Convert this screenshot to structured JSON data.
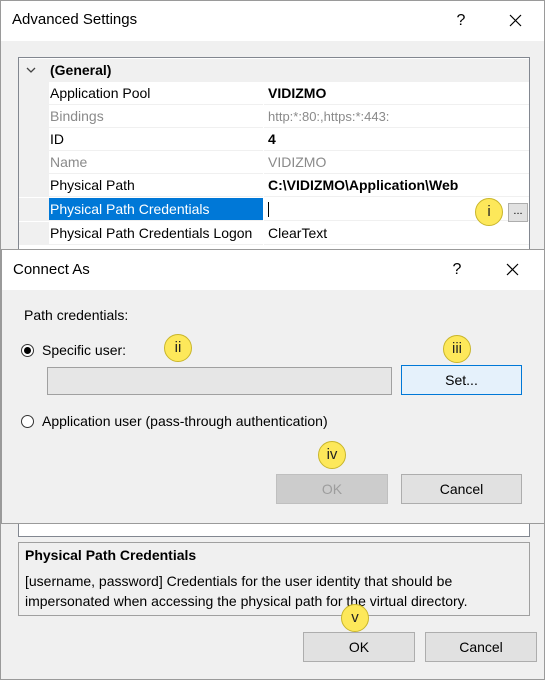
{
  "advanced": {
    "title": "Advanced Settings",
    "help": "?",
    "category": "(General)",
    "rows": [
      {
        "label": "Application Pool",
        "value": "VIDIZMO",
        "dim": false,
        "bold": true
      },
      {
        "label": "Bindings",
        "value": "http:*:80:,https:*:443:",
        "dim": true,
        "bold": false
      },
      {
        "label": "ID",
        "value": "4",
        "dim": false,
        "bold": true
      },
      {
        "label": "Name",
        "value": "VIDIZMO",
        "dim": true,
        "bold": false
      },
      {
        "label": "Physical Path",
        "value": "C:\\VIDIZMO\\Application\\Web",
        "dim": false,
        "bold": true
      },
      {
        "label": "Physical Path Credentials",
        "value": "",
        "dim": false,
        "bold": false
      },
      {
        "label": "Physical Path Credentials Logon",
        "value": "ClearText",
        "dim": false,
        "bold": false
      }
    ],
    "ellipsis": "...",
    "description": {
      "title": "Physical Path Credentials",
      "text": "[username, password] Credentials for the user identity that should be impersonated when accessing the physical path for the virtual directory."
    },
    "ok_label": "OK",
    "cancel_label": "Cancel"
  },
  "connect_as": {
    "title": "Connect As",
    "help": "?",
    "section_label": "Path credentials:",
    "specific_user_label": "Specific user:",
    "set_label": "Set...",
    "app_user_label": "Application user (pass-through authentication)",
    "ok_label": "OK",
    "cancel_label": "Cancel"
  },
  "markers": {
    "i": "i",
    "ii": "ii",
    "iii": "iii",
    "iv": "iv",
    "v": "v"
  },
  "colors": {
    "selection": "#0078d7",
    "marker": "#fde85a",
    "window_bg": "#f0f0f0"
  }
}
